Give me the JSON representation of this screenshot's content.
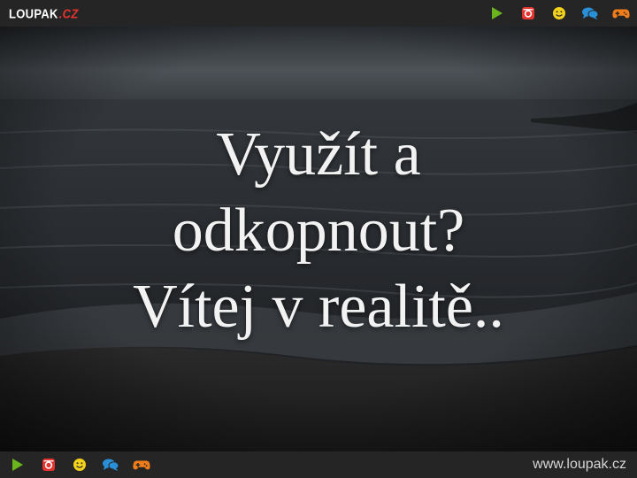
{
  "header": {
    "logo_main": "LOUPAK",
    "logo_tld": ".CZ",
    "icons": [
      "play-icon",
      "instagram-icon",
      "smiley-icon",
      "chat-icon",
      "gamepad-icon"
    ]
  },
  "footer": {
    "icons": [
      "play-icon",
      "instagram-icon",
      "smiley-icon",
      "chat-icon",
      "gamepad-icon"
    ],
    "site_url": "www.loupak.cz"
  },
  "quote": {
    "lines": [
      "Využít a",
      "odkopnout?",
      "Vítej v realitě.."
    ]
  },
  "colors": {
    "bar_background": "#252525",
    "logo_accent": "#e3342f",
    "play": "#6ab41e",
    "instagram": "#e3342f",
    "smiley": "#f4d11a",
    "chat": "#2a8fd6",
    "gamepad": "#f07d1a"
  }
}
